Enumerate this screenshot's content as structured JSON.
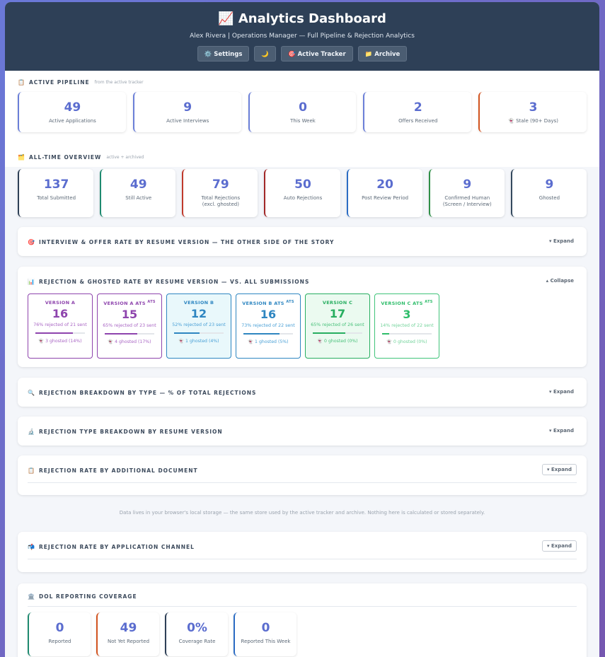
{
  "header": {
    "title": "📈 Analytics Dashboard",
    "subtitle": "Alex Rivera | Operations Manager — Full Pipeline & Rejection Analytics",
    "buttons": [
      {
        "icon": "⚙️",
        "label": "Settings"
      },
      {
        "icon": "🌙",
        "label": ""
      },
      {
        "icon": "🎯",
        "label": "Active Tracker"
      },
      {
        "icon": "📁",
        "label": "Archive"
      }
    ]
  },
  "pipeline": {
    "icon": "📋",
    "title": "Active Pipeline",
    "note": "from the active tracker",
    "cards": [
      {
        "value": "49",
        "label": "Active Applications"
      },
      {
        "value": "9",
        "label": "Active Interviews"
      },
      {
        "value": "0",
        "label": "This Week"
      },
      {
        "value": "2",
        "label": "Offers Received"
      },
      {
        "value": "3",
        "label": "👻 Stale (90+ Days)"
      }
    ]
  },
  "overview": {
    "icon": "🗂️",
    "title": "All-Time Overview",
    "note": "active + archived",
    "cards": [
      {
        "value": "137",
        "label": "Total Submitted",
        "label2": ""
      },
      {
        "value": "49",
        "label": "Still Active",
        "label2": ""
      },
      {
        "value": "79",
        "label": "Total Rejections",
        "label2": "(excl. ghosted)"
      },
      {
        "value": "50",
        "label": "Auto Rejections",
        "label2": ""
      },
      {
        "value": "20",
        "label": "Post Review Period",
        "label2": ""
      },
      {
        "value": "9",
        "label": "Confirmed Human",
        "label2": "(Screen / Interview)"
      },
      {
        "value": "9",
        "label": "Ghosted",
        "label2": ""
      }
    ]
  },
  "panels": {
    "interview": {
      "icon": "🎯",
      "title": "Interview & Offer Rate by Resume Version — The Other Side of the Story",
      "toggle": "▾ Expand"
    },
    "rejection": {
      "icon": "📊",
      "title": "Rejection & Ghosted Rate by Resume Version — vs. All Submissions",
      "toggle": "▴ Collapse"
    },
    "breakdown": {
      "icon": "🔍",
      "title": "Rejection Breakdown by Type — % of Total Rejections",
      "toggle": "▾ Expand"
    },
    "typeByVersion": {
      "icon": "🔬",
      "title": "Rejection Type Breakdown by Resume Version",
      "toggle": "▾ Expand"
    },
    "additionalDoc": {
      "icon": "📋",
      "title": "Rejection Rate by Additional Document",
      "toggle": "▾ Expand"
    },
    "channel": {
      "icon": "📬",
      "title": "Rejection Rate by Application Channel",
      "toggle": "▾ Expand"
    },
    "dol": {
      "icon": "🏛️",
      "title": "DOL Reporting Coverage"
    }
  },
  "versions": [
    {
      "name": "VERSION A",
      "ats": "",
      "value": "16",
      "desc": "76% rejected of 21 sent",
      "rate": 0.76,
      "ghosted": "👻 3 ghosted (14%)"
    },
    {
      "name": "VERSION A ATS",
      "ats": "ATS",
      "value": "15",
      "desc": "65% rejected of 23 sent",
      "rate": 0.65,
      "ghosted": "👻 4 ghosted (17%)"
    },
    {
      "name": "VERSION B",
      "ats": "",
      "value": "12",
      "desc": "52% rejected of 23 sent",
      "rate": 0.52,
      "ghosted": "👻 1 ghosted (4%)"
    },
    {
      "name": "VERSION B ATS",
      "ats": "ATS",
      "value": "16",
      "desc": "73% rejected of 22 sent",
      "rate": 0.73,
      "ghosted": "👻 1 ghosted (5%)"
    },
    {
      "name": "VERSION C",
      "ats": "",
      "value": "17",
      "desc": "65% rejected of 26 sent",
      "rate": 0.65,
      "ghosted": "👻 0 ghosted (0%)"
    },
    {
      "name": "VERSION C ATS",
      "ats": "ATS",
      "value": "3",
      "desc": "14% rejected of 22 sent",
      "rate": 0.14,
      "ghosted": "👻 0 ghosted (0%)"
    }
  ],
  "footnote": "Data lives in your browser's local storage — the same store used by the active tracker and archive. Nothing here is calculated or stored separately.",
  "dol": {
    "cards": [
      {
        "value": "0",
        "label": "Reported"
      },
      {
        "value": "49",
        "label": "Not Yet Reported"
      },
      {
        "value": "0%",
        "label": "Coverage Rate"
      },
      {
        "value": "0",
        "label": "Reported This Week"
      }
    ]
  }
}
